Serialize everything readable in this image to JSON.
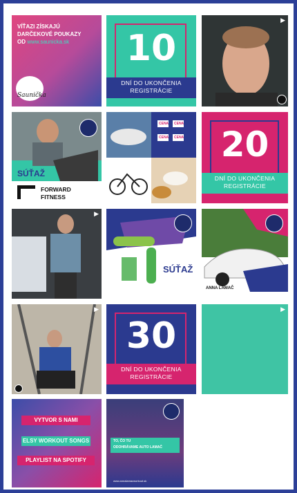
{
  "tiles": {
    "t1": {
      "line1": "VÍŤAZI ZÍSKAJÚ",
      "line2": "DARČEKOVÉ POUKAZY",
      "line3_prefix": "OD",
      "line3_url": "www.saunicka.sk",
      "logo": "Saunička"
    },
    "t2": {
      "number": "10",
      "line1": "DNÍ DO UKONČENIA",
      "line2": "REGISTRÁCIE"
    },
    "t5": {
      "labels": [
        "CENA",
        "CENA",
        "CENA",
        "CENA",
        "CENA"
      ]
    },
    "t6": {
      "number": "20",
      "line1": "DNÍ DO UKONČENIA",
      "line2": "REGISTRÁCIE"
    },
    "t4": {
      "contest": "SÚŤAŽ",
      "brand_line1": "FORWARD",
      "brand_line2": "FITNESS"
    },
    "t8": {
      "contest": "SÚŤAŽ"
    },
    "t9": {
      "brand": "ANNA LAMAČ"
    },
    "t11": {
      "number": "30",
      "line1": "DNÍ DO UKONČENIA",
      "line2": "REGISTRÁCIE"
    },
    "t13": {
      "line1": "VYTVOR S NAMI",
      "line2": "ELSY WORKOUT SONGS",
      "line3": "PLAYLIST NA SPOTIFY"
    },
    "t14": {
      "line1": "TO, ČO TU",
      "line2": "ODOHRÁVAME AUTO LAMAČ",
      "url": "www.annalamacworkout.sk"
    }
  },
  "colors": {
    "border": "#2c3f97",
    "teal": "#34c6a6",
    "magenta": "#d6246e",
    "navy": "#2b3a8f",
    "pink": "#e94b8a"
  },
  "icons": {
    "video": "video-icon",
    "badge": "challenge-badge-icon"
  }
}
